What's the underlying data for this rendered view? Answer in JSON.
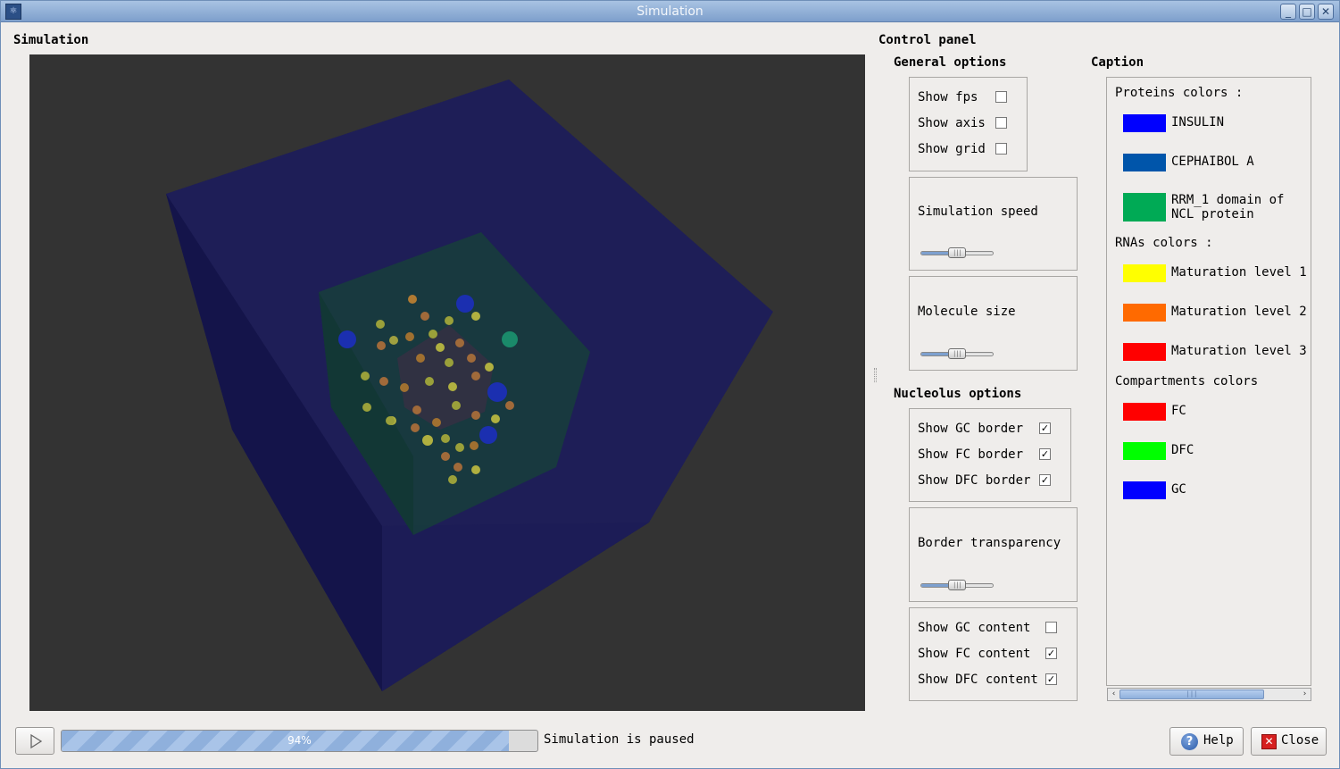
{
  "window": {
    "title": "Simulation",
    "app_icon": "molecule-app-icon"
  },
  "simulation_panel": {
    "heading": "Simulation"
  },
  "control_panel": {
    "heading": "Control panel",
    "general": {
      "heading": "General options",
      "checkboxes": [
        {
          "label": "Show fps",
          "checked": false
        },
        {
          "label": "Show axis",
          "checked": false
        },
        {
          "label": "Show grid",
          "checked": false
        }
      ],
      "speed_label": "Simulation speed",
      "speed_value": 0.5,
      "size_label": "Molecule size",
      "size_value": 0.5
    },
    "nucleolus": {
      "heading": "Nucleolus options",
      "borders": [
        {
          "label": "Show GC border",
          "checked": true
        },
        {
          "label": "Show FC border",
          "checked": true
        },
        {
          "label": "Show DFC border",
          "checked": true
        }
      ],
      "transparency_label": "Border transparency",
      "transparency_value": 0.5,
      "contents": [
        {
          "label": "Show GC content",
          "checked": false
        },
        {
          "label": "Show FC content",
          "checked": true
        },
        {
          "label": "Show DFC content",
          "checked": true
        }
      ]
    }
  },
  "caption": {
    "heading": "Caption",
    "proteins_heading": "Proteins colors :",
    "proteins": [
      {
        "label": "INSULIN",
        "color": "#0000ff"
      },
      {
        "label": "CEPHAIBOL A",
        "color": "#0055aa"
      },
      {
        "label": "RRM_1 domain of NCL protein",
        "label_line1": "RRM_1 domain of",
        "label_line2": "NCL protein",
        "color": "#00aa55"
      }
    ],
    "rnas_heading": "RNAs colors :",
    "rnas": [
      {
        "label": "Maturation level 1",
        "color": "#ffff00"
      },
      {
        "label": "Maturation level 2",
        "color": "#ff6a00"
      },
      {
        "label": "Maturation level 3",
        "color": "#ff0000"
      }
    ],
    "compartments_heading": "Compartments colors",
    "compartments": [
      {
        "label": "FC",
        "color": "#ff0000"
      },
      {
        "label": "DFC",
        "color": "#00ff00"
      },
      {
        "label": "GC",
        "color": "#0000ff"
      }
    ]
  },
  "footer": {
    "progress_percent": 94,
    "progress_text": "94%",
    "status": "Simulation is paused",
    "help_label": "Help",
    "close_label": "Close"
  }
}
